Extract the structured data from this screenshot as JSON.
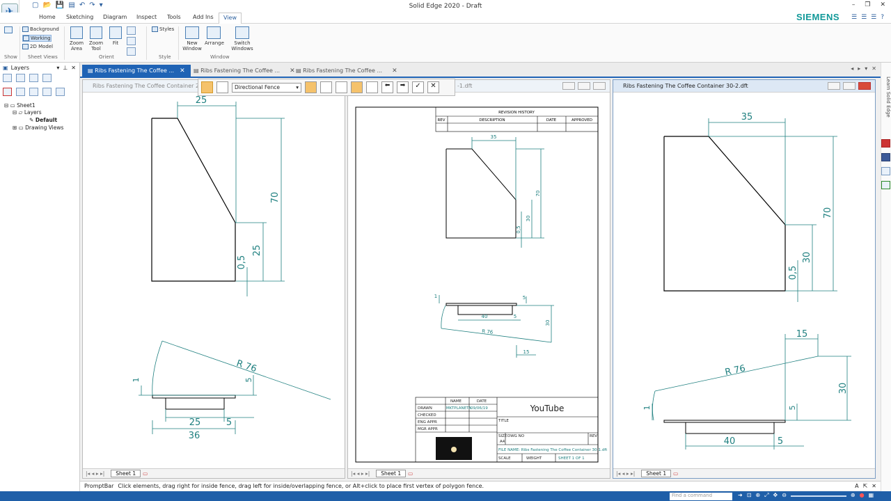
{
  "app": {
    "title": "Solid Edge 2020 - Draft",
    "brand": "SIEMENS"
  },
  "ribbon": {
    "tabs": [
      "Home",
      "Sketching",
      "Diagram",
      "Inspect",
      "Tools",
      "Add Ins",
      "View"
    ],
    "selected_tab": "View",
    "show_group": "Show",
    "sheet_views": {
      "label": "Sheet Views",
      "background": "Background",
      "working": "Working",
      "model2d": "2D Model"
    },
    "orient": {
      "label": "Orient",
      "zoom_area": "Zoom Area",
      "zoom_tool": "Zoom Tool",
      "fit": "Fit"
    },
    "style": {
      "label": "Style",
      "styles": "Styles"
    },
    "window": {
      "label": "Window",
      "new_window": "New Window",
      "arrange": "Arrange",
      "switch_windows": "Switch Windows"
    }
  },
  "left_pane": {
    "title": "Layers",
    "tree": {
      "sheet": "Sheet1",
      "layers": "Layers",
      "default": "Default",
      "drawing_views": "Drawing Views"
    }
  },
  "doc_tabs": [
    {
      "label": "Ribs Fastening The Coffee ...",
      "selected": true
    },
    {
      "label": "Ribs Fastening The Coffee ...",
      "selected": false
    },
    {
      "label": "Ribs Fastening The Coffee ...",
      "selected": false
    }
  ],
  "windows": {
    "left": {
      "title": "Ribs Fastening The Coffee Container 20.dft",
      "sheet": "Sheet 1"
    },
    "middle": {
      "title": "-1.dft",
      "sheet": "Sheet 1"
    },
    "right": {
      "title": "Ribs Fastening The Coffee Container 30-2.dft",
      "sheet": "Sheet 1"
    }
  },
  "fence_toolbar": {
    "selected_option": "Directional Fence"
  },
  "drawing_left": {
    "dims": {
      "top": "25",
      "height": "70",
      "mid": "25",
      "small": "0,5",
      "radius": "R 76",
      "thk": "1",
      "five_v": "5",
      "d25": "25",
      "d5": "5",
      "d36": "36"
    }
  },
  "drawing_middle": {
    "revision_history": "REVISION HISTORY",
    "rev_cols": [
      "REV",
      "DESCRIPTION",
      "DATE",
      "APPROVED"
    ],
    "dims": {
      "top": "35",
      "h70": "70",
      "h30": "30",
      "small": "0,5",
      "one": "1",
      "five": "5",
      "forty": "40",
      "r76": "R 76",
      "fifteen": "15",
      "thirty": "30"
    },
    "title_block": {
      "name": "NAME",
      "date": "DATE",
      "drawn": "DRAWN",
      "drawn_by": "MKTPLANETA",
      "drawn_date": "09/06/19",
      "checked": "CHECKED",
      "eng_appr": "ENG APPR",
      "mgr_appr": "MGR APPR",
      "company": "YouTube",
      "title_lbl": "TITLE",
      "size": "SIZE",
      "size_val": "A4",
      "dwg_no": "DWG NO",
      "rev": "REV",
      "file_name": "FILE NAME: Ribs Fastening The Coffee Container 30-1.dft",
      "scale": "SCALE",
      "weight": "WEIGHT",
      "sheet": "SHEET 1 OF 1"
    }
  },
  "drawing_right": {
    "dims": {
      "top": "35",
      "h70": "70",
      "h30": "30",
      "small": "0,5",
      "fifteen": "15",
      "r76": "R 76",
      "thirty": "30",
      "one": "1",
      "five": "5",
      "forty": "40",
      "five_b": "5"
    }
  },
  "learn": "Learn Solid Edge",
  "prompt": {
    "label": "PromptBar",
    "text": "Click elements, drag right for inside fence, drag left for inside/overlapping fence, or Alt+click to place first vertex of polygon fence."
  },
  "status": {
    "find_placeholder": "Find a command"
  }
}
